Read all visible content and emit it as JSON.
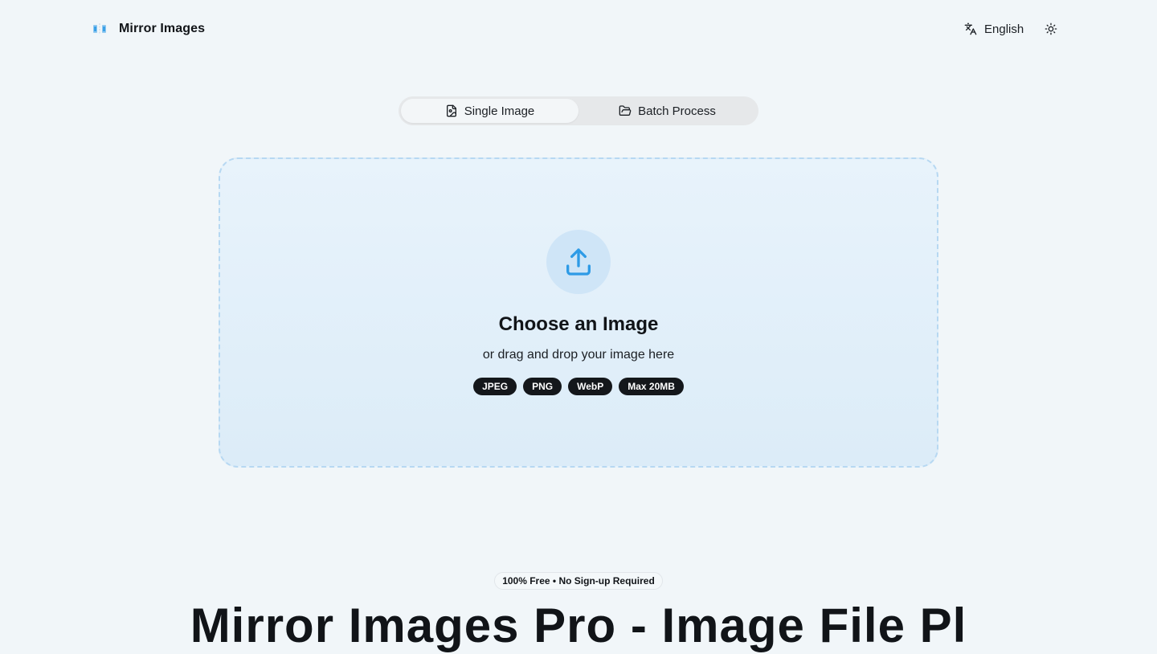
{
  "header": {
    "brand_name": "Mirror Images",
    "language_label": "English"
  },
  "mode_tabs": [
    {
      "label": "Single Image",
      "active": true
    },
    {
      "label": "Batch Process",
      "active": false
    }
  ],
  "dropzone": {
    "title": "Choose an Image",
    "subtitle": "or drag and drop your image here",
    "badges": [
      "JPEG",
      "PNG",
      "WebP",
      "Max 20MB"
    ]
  },
  "hero": {
    "pill": "100% Free • No Sign-up Required",
    "title_partial": "Mirror Images Pro - Image File Pl"
  },
  "colors": {
    "page_bg": "#f1f6f9",
    "accent": "#2e9be6",
    "dropzone_border": "#b7d8f2",
    "badge_bg": "#14171b"
  },
  "icons": {
    "brand": "mirror-logo-icon",
    "language": "translate-icon",
    "theme": "sun-icon",
    "single_tab": "image-file-icon",
    "batch_tab": "folder-open-icon",
    "upload": "upload-icon"
  }
}
